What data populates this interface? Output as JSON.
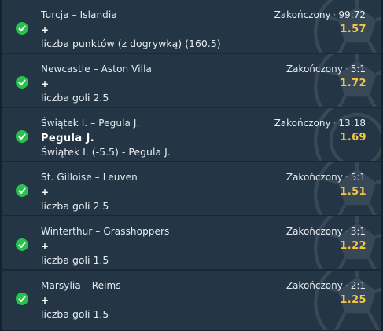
{
  "bets": [
    {
      "match": "Turcja – Islandia",
      "status": "Zakończony",
      "score": "99:72",
      "pick": "+",
      "market": "liczba punktów (z dogrywką) (160.5)",
      "odds": "1.57"
    },
    {
      "match": "Newcastle – Aston Villa",
      "status": "Zakończony",
      "score": "5:1",
      "pick": "+",
      "market": "liczba goli 2.5",
      "odds": "1.72"
    },
    {
      "match": "Świątek I. – Pegula J.",
      "status": "Zakończony",
      "score": "13:18",
      "pick": "Pegula J.",
      "market": "Świątek I. (-5.5) - Pegula J.",
      "odds": "1.69"
    },
    {
      "match": "St. Gilloise – Leuven",
      "status": "Zakończony",
      "score": "5:1",
      "pick": "+",
      "market": "liczba goli 2.5",
      "odds": "1.51"
    },
    {
      "match": "Winterthur – Grasshoppers",
      "status": "Zakończony",
      "score": "3:1",
      "pick": "+",
      "market": "liczba goli 1.5",
      "odds": "1.22"
    },
    {
      "match": "Marsylia – Reims",
      "status": "Zakończony",
      "score": "2:1",
      "pick": "+",
      "market": "liczba goli 1.5",
      "odds": "1.25"
    }
  ],
  "colors": {
    "win": "#27c24c",
    "odds": "#f5c642",
    "row_bg": "#243646"
  },
  "icons": {
    "status": "check-circle-icon",
    "sport": "ball-watermark-icon"
  }
}
